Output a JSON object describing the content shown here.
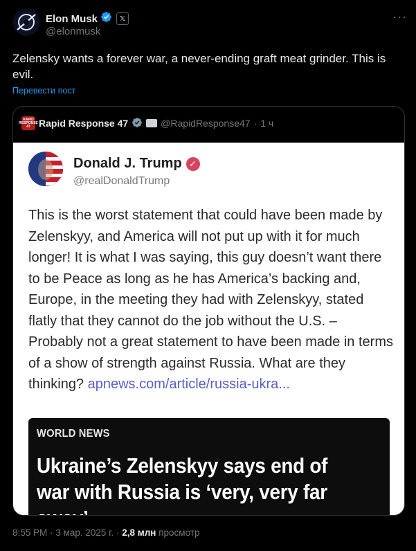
{
  "author": {
    "name": "Elon Musk",
    "handle": "@elonmusk",
    "verified_icon": "verified-badge-blue",
    "affiliate_badge": "𝕏"
  },
  "tweet": {
    "text": "Zelensky wants a forever war, a never-ending graft meat grinder. This is evil.",
    "translate_label": "Перевести пост"
  },
  "quote": {
    "name": "Rapid Response 47",
    "handle": "@RapidResponse47",
    "separator": "·",
    "time": "1 ч",
    "avatar_text": "RAPID RESPONSE 47",
    "embedded": {
      "name": "Donald J. Trump",
      "handle": "@realDonaldTrump",
      "body": "This is the worst statement that could have been made by Zelenskyy, and America will not put up with it for much longer! It is what I was saying, this guy doesn’t want there to be Peace as long as he has America’s backing and, Europe, in the meeting they had with Zelenskyy, stated flatly that they cannot do the job without the U.S. – Probably not a great statement to have been made in terms of a show of strength against Russia. What are they thinking?",
      "link": "apnews.com/article/russia-ukra...",
      "news_tag": "WORLD NEWS",
      "news_headline": "Ukraine’s Zelenskyy says end of war with Russia is ‘very, very far away’"
    }
  },
  "footer": {
    "time": "8:55 PM",
    "dot": "·",
    "date": "3 мар. 2025 г.",
    "views_count": "2,8 млн",
    "views_label": "просмотр"
  },
  "colors": {
    "background": "#000000",
    "accent": "#1d9bf0",
    "muted": "#71767b",
    "truth_verified": "#d8435e"
  }
}
